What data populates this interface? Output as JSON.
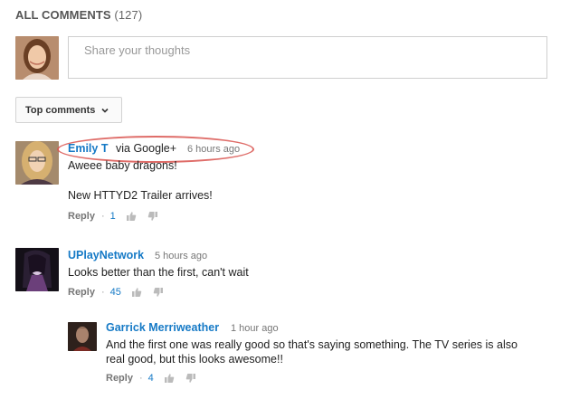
{
  "header": {
    "title": "ALL COMMENTS",
    "count": "(127)"
  },
  "composer": {
    "placeholder": "Share your thoughts"
  },
  "sort": {
    "label": "Top comments"
  },
  "comments": [
    {
      "author": "Emily T",
      "via": "via Google+",
      "time": "6 hours ago",
      "lines": [
        "Aweee baby dragons!",
        "New HTTYD2 Trailer arrives!"
      ],
      "reply": "Reply",
      "likes": "1"
    },
    {
      "author": "UPlayNetwork",
      "time": "5 hours ago",
      "lines": [
        "Looks better than the first, can't wait"
      ],
      "reply": "Reply",
      "likes": "45"
    },
    {
      "author": "Garrick Merriweather",
      "time": "1 hour ago",
      "lines": [
        "And the first one was really good so that's saying something. The TV series is also",
        "real good, but this looks awesome!!"
      ],
      "reply": "Reply",
      "likes": "4"
    }
  ],
  "colors": {
    "link": "#167ac6",
    "highlight": "#d9534f"
  }
}
